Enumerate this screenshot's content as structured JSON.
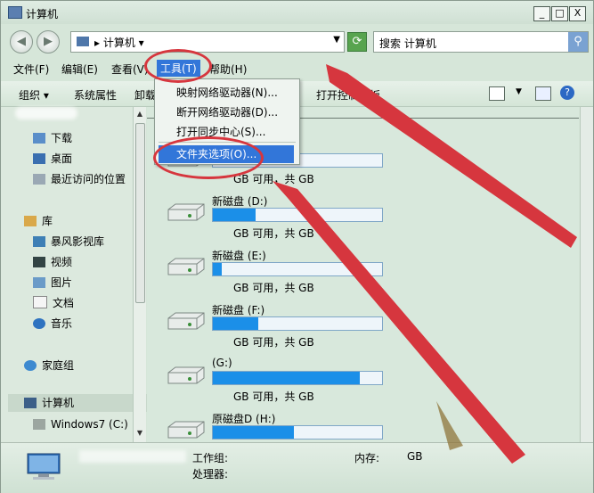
{
  "window": {
    "title": "计算机",
    "buttons": [
      "_",
      "□",
      "X"
    ]
  },
  "address": {
    "path": "计算机",
    "search_placeholder": "搜索 计算机"
  },
  "menu": {
    "file": "文件(F)",
    "edit": "编辑(E)",
    "view": "查看(V)",
    "tools": "工具(T)",
    "help": "帮助(H)"
  },
  "toolbar": {
    "organize": "组织",
    "properties": "系统属性",
    "uninstall": "卸载",
    "control_panel": "打开控制面板"
  },
  "tools_menu": {
    "items": [
      "映射网络驱动器(N)...",
      "断开网络驱动器(D)...",
      "打开同步中心(S)...",
      "文件夹选项(O)..."
    ]
  },
  "sidebar": {
    "favorites": [
      {
        "label": "下载"
      },
      {
        "label": "桌面"
      },
      {
        "label": "最近访问的位置"
      }
    ],
    "library": "库",
    "libraries": [
      {
        "label": "暴风影视库"
      },
      {
        "label": "视频"
      },
      {
        "label": "图片"
      },
      {
        "label": "文档"
      },
      {
        "label": "音乐"
      }
    ],
    "homegroup": "家庭组",
    "computer": "计算机",
    "drive": "Windows7 (C:)"
  },
  "drives": [
    {
      "name": "",
      "fill": 0.0,
      "stats": "GB 可用，共     GB"
    },
    {
      "name": "新磁盘 (D:)",
      "fill": 0.25,
      "stats": "GB 可用，共     GB"
    },
    {
      "name": "新磁盘 (E:)",
      "fill": 0.05,
      "stats": "GB 可用，共     GB"
    },
    {
      "name": "新磁盘 (F:)",
      "fill": 0.27,
      "stats": "GB 可用，共     GB"
    },
    {
      "name": "(G:)",
      "fill": 0.87,
      "stats": "GB 可用，共     GB"
    },
    {
      "name": "原磁盘D (H:)",
      "fill": 0.48,
      "stats": ""
    }
  ],
  "details": {
    "workgroup": "工作组:",
    "processor": "处理器:",
    "memory": "内存:",
    "memory_unit": "GB"
  }
}
